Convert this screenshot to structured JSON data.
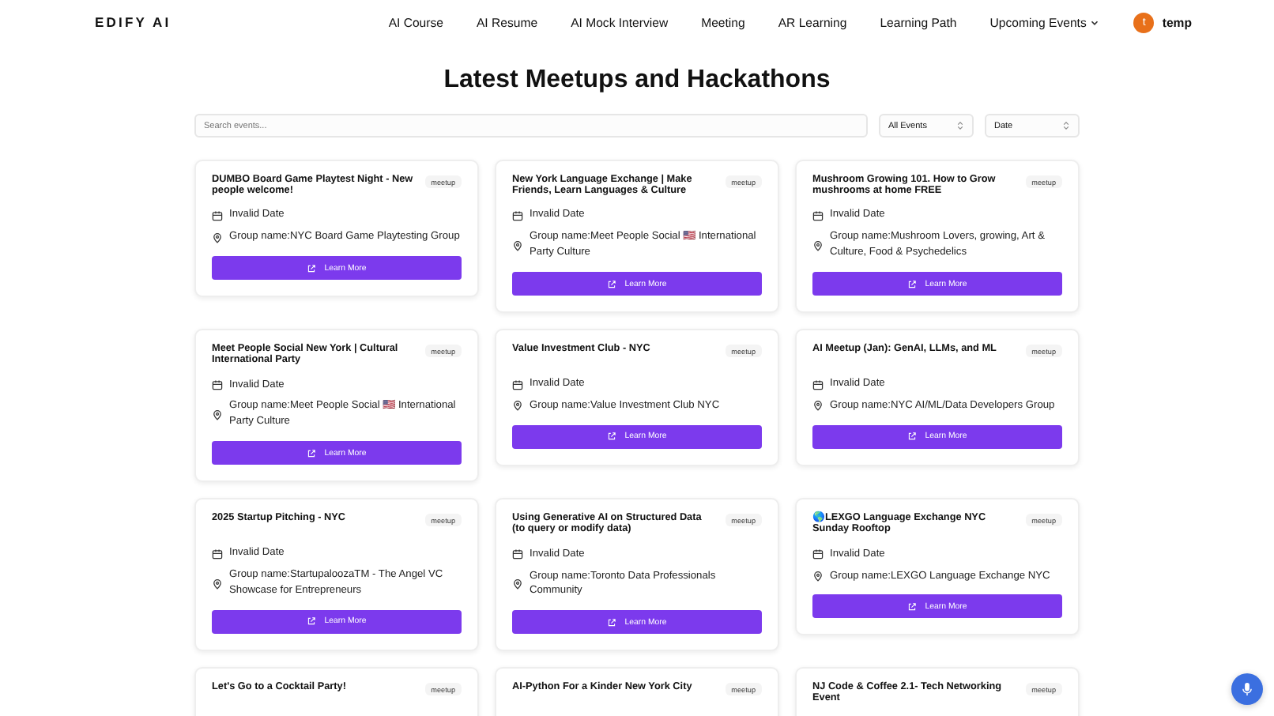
{
  "header": {
    "logo": "EDIFY AI",
    "nav": [
      {
        "label": "AI Course",
        "kind": "link"
      },
      {
        "label": "AI Resume",
        "kind": "link"
      },
      {
        "label": "AI Mock Interview",
        "kind": "link"
      },
      {
        "label": "Meeting",
        "kind": "link"
      },
      {
        "label": "AR Learning",
        "kind": "link"
      },
      {
        "label": "Learning Path",
        "kind": "link"
      },
      {
        "label": "Upcoming Events",
        "kind": "dropdown"
      }
    ],
    "user": {
      "initial": "t",
      "name": "temp"
    }
  },
  "page_title": "Latest Meetups and Hackathons",
  "filters": {
    "search": {
      "placeholder": "Search events..."
    },
    "selects": [
      "All Events",
      "Date"
    ]
  },
  "events": [
    {
      "title": "DUMBO Board Game Playtest Night - New people welcome!",
      "badge": "meetup",
      "date": "Invalid Date",
      "group": "Group name:NYC Board Game Playtesting Group",
      "button": "Learn More"
    },
    {
      "title": "New York Language Exchange | Make Friends, Learn Languages & Culture",
      "badge": "meetup",
      "date": "Invalid Date",
      "group": "Group name:Meet People Social 🇺🇸 International Party Culture",
      "button": "Learn More"
    },
    {
      "title": "Mushroom Growing 101. How to Grow mushrooms at home FREE",
      "badge": "meetup",
      "date": "Invalid Date",
      "group": "Group name:Mushroom Lovers, growing, Art & Culture, Food & Psychedelics",
      "button": "Learn More"
    },
    {
      "title": "Meet People Social New York | Cultural International Party",
      "badge": "meetup",
      "date": "Invalid Date",
      "group": "Group name:Meet People Social 🇺🇸 International Party Culture",
      "button": "Learn More"
    },
    {
      "title": "Value Investment Club - NYC",
      "badge": "meetup",
      "date": "Invalid Date",
      "group": "Group name:Value Investment Club NYC",
      "button": "Learn More"
    },
    {
      "title": "AI Meetup (Jan): GenAI, LLMs, and ML",
      "badge": "meetup",
      "date": "Invalid Date",
      "group": "Group name:NYC AI/ML/Data Developers Group",
      "button": "Learn More"
    },
    {
      "title": "2025 Startup Pitching - NYC",
      "badge": "meetup",
      "date": "Invalid Date",
      "group": "Group name:StartupaloozaTM - The Angel VC Showcase for Entrepreneurs",
      "button": "Learn More"
    },
    {
      "title": "Using Generative AI on Structured Data (to query or modify data)",
      "badge": "meetup",
      "date": "Invalid Date",
      "group": "Group name:Toronto Data Professionals Community",
      "button": "Learn More"
    },
    {
      "title": "🌎LEXGO Language Exchange NYC Sunday Rooftop",
      "badge": "meetup",
      "date": "Invalid Date",
      "group": "Group name:LEXGO Language Exchange NYC",
      "button": "Learn More"
    },
    {
      "title": "Let's Go to a Cocktail Party!",
      "badge": "meetup"
    },
    {
      "title": "AI-Python For a Kinder New York City",
      "badge": "meetup"
    },
    {
      "title": "NJ Code & Coffee 2.1- Tech Networking Event",
      "badge": "meetup"
    }
  ]
}
